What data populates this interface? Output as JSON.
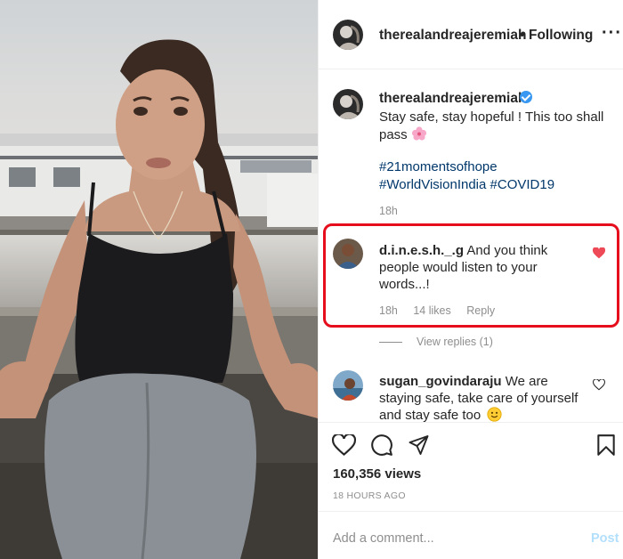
{
  "post": {
    "author": "therealandreajeremiah",
    "follow_sep": "•",
    "follow_label": "Following",
    "more_label": "···",
    "caption_text": "Stay safe, stay hopeful ! This too shall pass",
    "hashtags": [
      "#21momentsofhope",
      "#WorldVisionIndia #COVID19"
    ],
    "caption_time": "18h"
  },
  "comments": [
    {
      "username": "d.i.n.e.s.h._.g",
      "text": "And you think people would listen to your words...!",
      "time": "18h",
      "likes": "14 likes",
      "reply_label": "Reply",
      "liked": true
    },
    {
      "username": "sugan_govindaraju",
      "text": "We are staying safe, take care of yourself and stay safe too",
      "liked": false
    }
  ],
  "view_replies": "View replies (1)",
  "stats": {
    "views": "160,356 views",
    "posted": "18 HOURS AGO"
  },
  "composer": {
    "placeholder": "Add a comment...",
    "post_label": "Post"
  },
  "colors": {
    "highlight": "#e60e1c",
    "like_red": "#ed4956",
    "link": "#00376b",
    "verified": "#3897f0",
    "muted": "#8e8e8e",
    "post_disabled": "#b2dffc"
  }
}
